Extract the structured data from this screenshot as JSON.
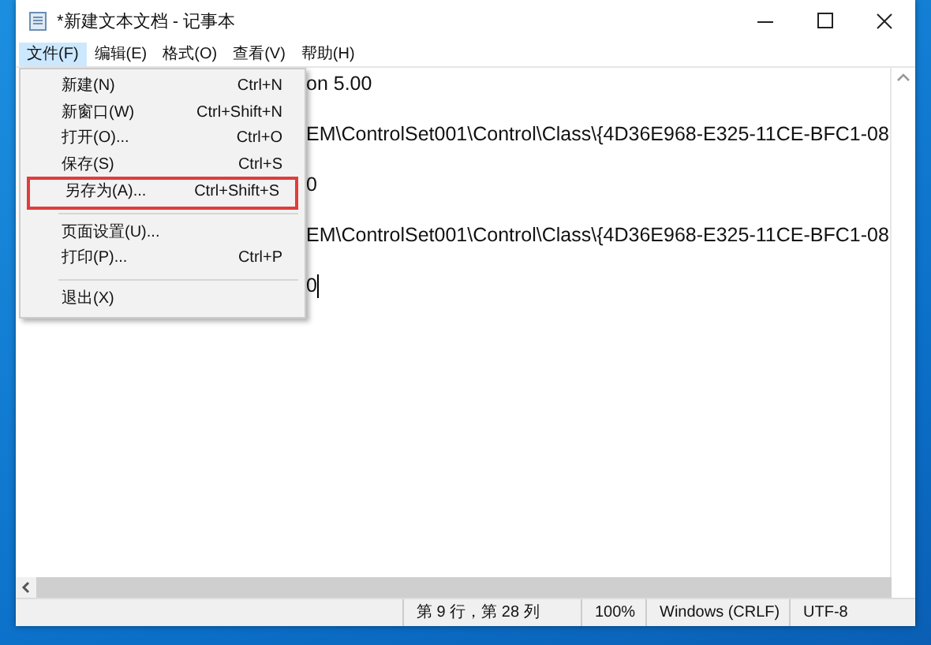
{
  "window": {
    "title": "*新建文本文档 - 记事本"
  },
  "menubar": [
    {
      "label": "文件(F)",
      "selected": true
    },
    {
      "label": "编辑(E)",
      "selected": false
    },
    {
      "label": "格式(O)",
      "selected": false
    },
    {
      "label": "查看(V)",
      "selected": false
    },
    {
      "label": "帮助(H)",
      "selected": false
    }
  ],
  "menu": [
    {
      "kind": "item",
      "label": "新建(N)",
      "shortcut": "Ctrl+N",
      "highlighted": false
    },
    {
      "kind": "item",
      "label": "新窗口(W)",
      "shortcut": "Ctrl+Shift+N",
      "highlighted": false
    },
    {
      "kind": "item",
      "label": "打开(O)...",
      "shortcut": "Ctrl+O",
      "highlighted": false
    },
    {
      "kind": "item",
      "label": "保存(S)",
      "shortcut": "Ctrl+S",
      "highlighted": false
    },
    {
      "kind": "item",
      "label": "另存为(A)...",
      "shortcut": "Ctrl+Shift+S",
      "highlighted": true
    },
    {
      "kind": "separator"
    },
    {
      "kind": "item",
      "label": "页面设置(U)...",
      "highlighted": false
    },
    {
      "kind": "item",
      "label": "打印(P)...",
      "shortcut": "Ctrl+P",
      "highlighted": false
    },
    {
      "kind": "separator"
    },
    {
      "kind": "item",
      "label": "退出(X)",
      "highlighted": false
    }
  ],
  "editor": {
    "lines": [
      "on 5.00",
      "EM\\ControlSet001\\Control\\Class\\{4D36E968-E325-11CE-BFC1-08",
      "0",
      "EM\\ControlSet001\\Control\\Class\\{4D36E968-E325-11CE-BFC1-08",
      "0"
    ]
  },
  "status_bar": [
    "第 9 行，第 28 列",
    "100%",
    "Windows (CRLF)",
    "UTF-8"
  ]
}
